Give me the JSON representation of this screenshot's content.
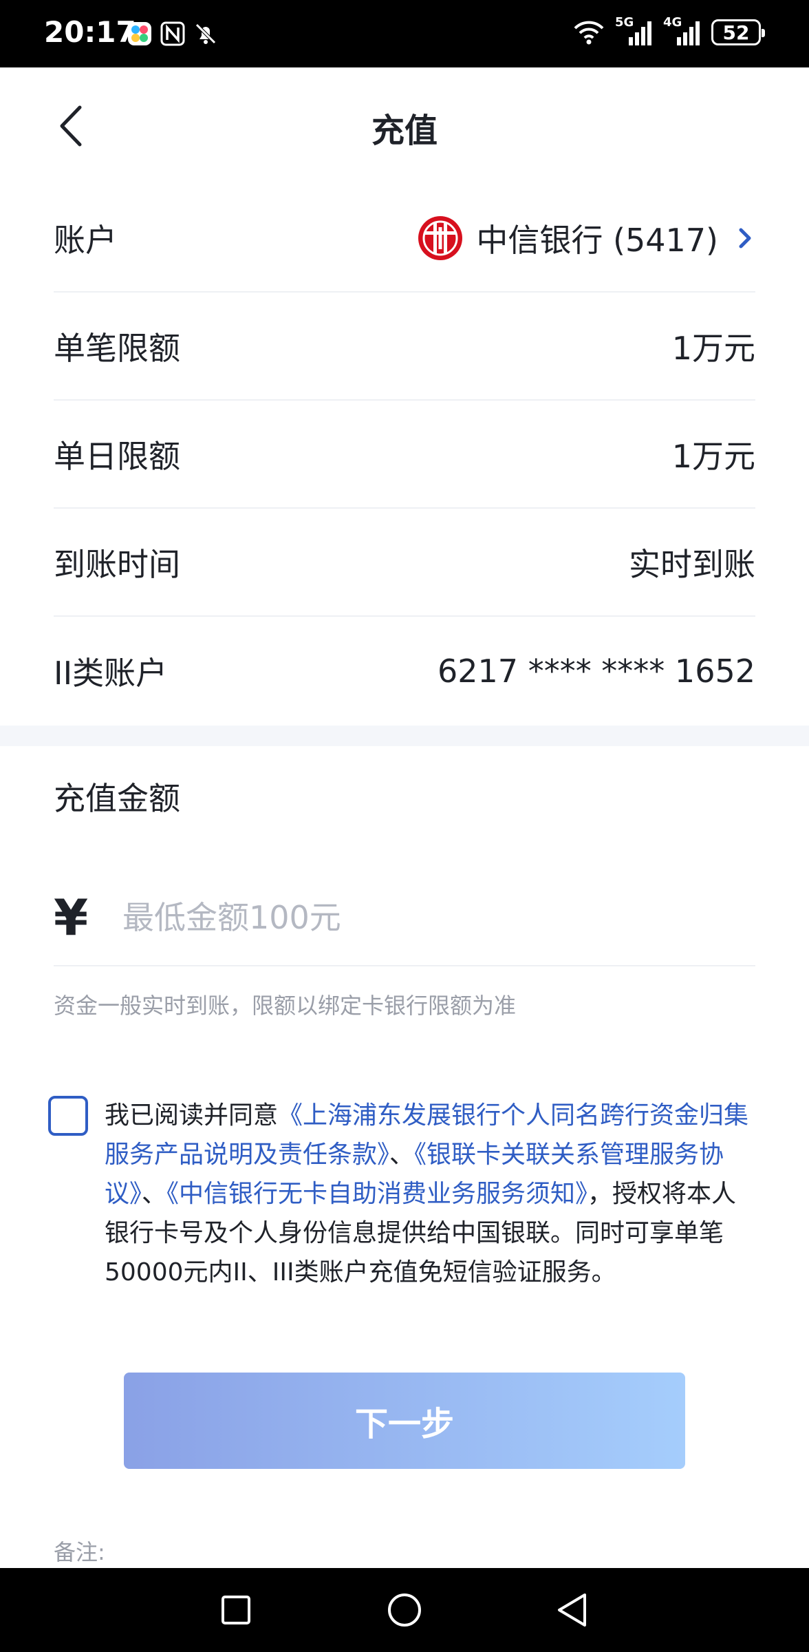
{
  "status_bar": {
    "time": "20:17",
    "battery": "52",
    "signal_labels": [
      "5G",
      "4G"
    ],
    "icons": [
      "app-icon",
      "nfc-icon",
      "bell-off-icon",
      "wifi-icon",
      "signal-5g-icon",
      "signal-4g-icon",
      "battery-icon"
    ]
  },
  "header": {
    "title": "充值",
    "back_icon": "chevron-left-icon"
  },
  "info_rows": [
    {
      "label": "账户",
      "value": "中信银行 (5417)",
      "logo_icon": "citic-bank-logo",
      "has_chevron": true
    },
    {
      "label": "单笔限额",
      "value": "1万元"
    },
    {
      "label": "单日限额",
      "value": "1万元"
    },
    {
      "label": "到账时间",
      "value": "实时到账"
    },
    {
      "label": "II类账户",
      "value": "6217 **** **** 1652"
    }
  ],
  "amount": {
    "title": "充值金额",
    "currency_symbol": "¥",
    "placeholder": "最低金额100元",
    "value": "",
    "hint": "资金一般实时到账，限额以绑定卡银行限额为准"
  },
  "agreement": {
    "checked": false,
    "prefix": "我已阅读并同意",
    "link1": "《上海浦东发展银行个人同名跨行资金归集服务产品说明及责任条款》",
    "sep1": "、",
    "link2": "《银联卡关联关系管理服务协议》",
    "sep2": "、",
    "link3": "《中信银行无卡自助消费业务服务须知》",
    "suffix": "，授权将本人银行卡号及个人身份信息提供给中国银联。同时可享单笔50000元内II、III类账户充值免短信验证服务。"
  },
  "next_button": {
    "label": "下一步"
  },
  "remark": {
    "label": "备注:"
  },
  "colors": {
    "accent": "#2f5dc4",
    "button_gradient_start": "#8aa1e6",
    "button_gradient_end": "#a5cdfc",
    "bank_logo_red": "#d7101e",
    "divider": "#eef0f4",
    "band": "#f4f6fa"
  },
  "nav_bar": {
    "icons": [
      "recent-apps-icon",
      "home-icon",
      "back-icon"
    ]
  }
}
